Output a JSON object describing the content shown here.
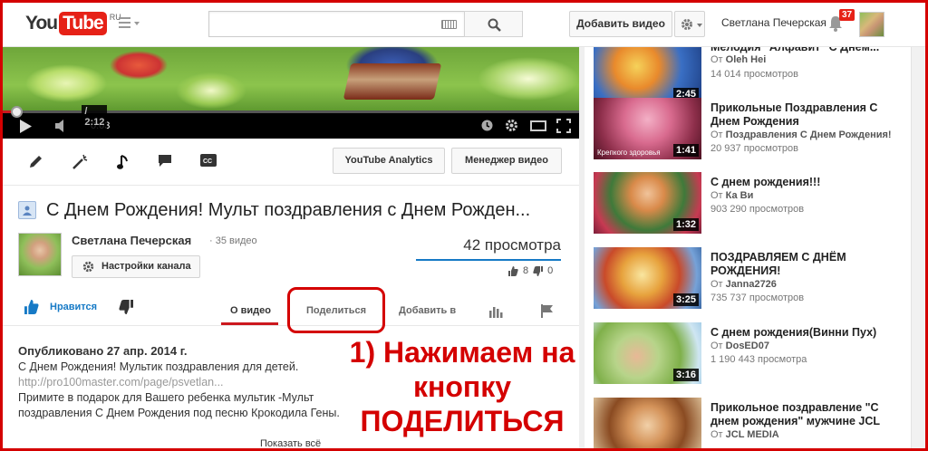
{
  "header": {
    "logo_you": "You",
    "logo_tube": "Tube",
    "logo_region": "RU",
    "search_placeholder": "",
    "upload_label": "Добавить видео",
    "user_name": "Светлана Печерская",
    "notification_count": "37"
  },
  "player": {
    "current_time": "0:03",
    "duration": "/ 2:12",
    "progress_fraction": 0.023
  },
  "editor": {
    "analytics_label": "YouTube Analytics",
    "manager_label": "Менеджер видео"
  },
  "video": {
    "title": "С Днем Рождения! Мульт поздравления с Днем Рожден...",
    "channel_name": "Светлана Печерская",
    "channel_count": "· 35 видео",
    "channel_settings_label": "Настройки канала",
    "views": "42 просмотра",
    "likes": "8",
    "dislikes": "0"
  },
  "actions": {
    "like_label": "Нравится",
    "tab_about": "О видео",
    "tab_share": "Поделиться",
    "tab_add": "Добавить в"
  },
  "description": {
    "published": "Опубликовано 27 апр. 2014 г.",
    "line1": "С Днем Рождения! Мультик поздравления для детей.",
    "link": "http://pro100master.com/page/psvetlan...",
    "line2": "Примите в подарок для Вашего ребенка мультик -Мульт",
    "line3": "поздравления С Днем Рождения под песню Крокодила Гены.",
    "show_more": "Показать всё"
  },
  "annotation": {
    "line1": "1) Нажимаем на",
    "line2": "кнопку",
    "line3": "ПОДЕЛИТЬСЯ"
  },
  "related": [
    {
      "title": "Мелодия \"Алфавит\" С Днём...",
      "channel": "Oleh Hei",
      "views": "14 014 просмотров",
      "duration": "2:45"
    },
    {
      "title": "Прикольные Поздравления С Днем Рождения",
      "channel": "Поздравления С Днем Рождения!",
      "views": "20 937 просмотров",
      "duration": "1:41",
      "thumb_text": "Крепкого здоровья"
    },
    {
      "title": "С днем рождения!!!",
      "channel": "Ка Ви",
      "views": "903 290 просмотров",
      "duration": "1:32"
    },
    {
      "title": "ПОЗДРАВЛЯЕМ С ДНЁМ РОЖДЕНИЯ!",
      "channel": "Janna2726",
      "views": "735 737 просмотров",
      "duration": "3:25"
    },
    {
      "title": "С днем рождения(Винни Пух)",
      "channel": "DosED07",
      "views": "1 190 443 просмотра",
      "duration": "3:16"
    },
    {
      "title": "Прикольное поздравление \"С днем рождения\" мужчине JCL",
      "channel": "JCL MEDIA",
      "views": "",
      "duration": ""
    }
  ],
  "related_prefix": "От "
}
